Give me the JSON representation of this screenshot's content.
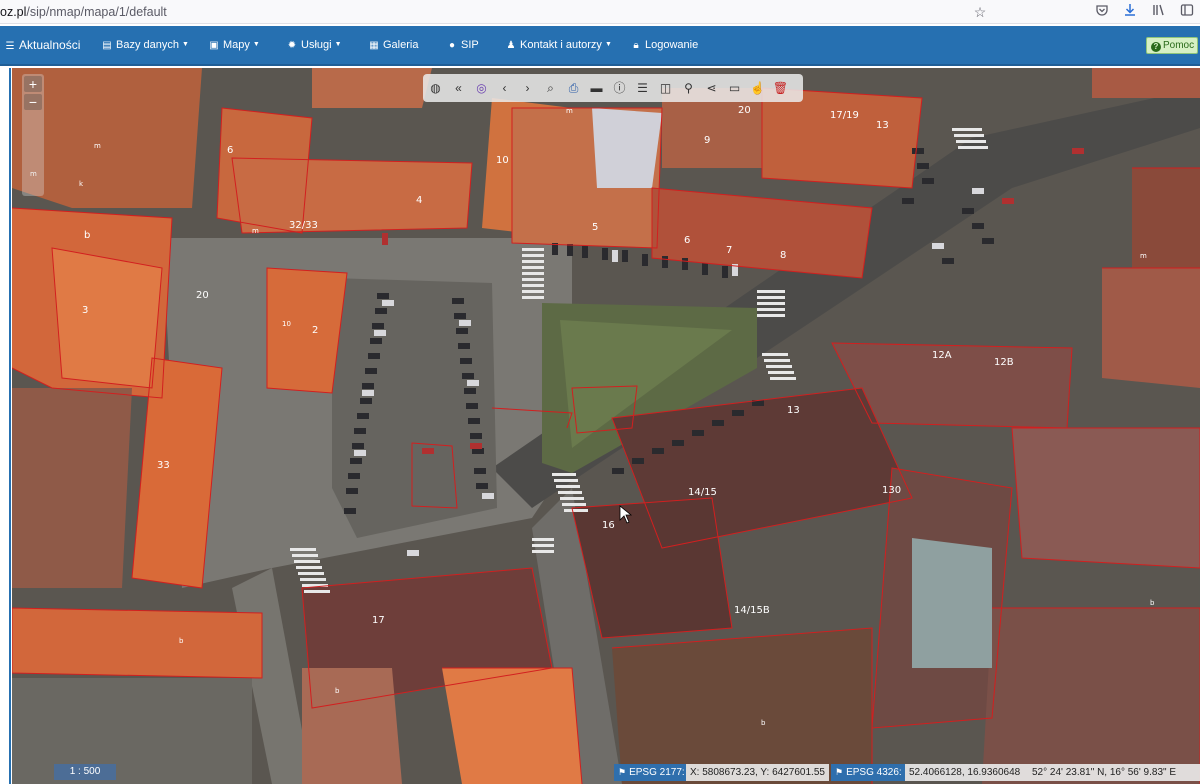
{
  "browser": {
    "url_host": "oz.pl",
    "url_path": "/sip/nmap/mapa/1/default",
    "icons": [
      "star-icon",
      "pocket-icon",
      "download-icon",
      "library-icon",
      "sidebar-icon"
    ]
  },
  "navbar": {
    "items": [
      {
        "label": "Aktualności",
        "icon": "menu-icon"
      },
      {
        "label": "Bazy danych",
        "icon": "list-icon",
        "dropdown": true
      },
      {
        "label": "Mapy",
        "icon": "picture-icon",
        "dropdown": true
      },
      {
        "label": "Usługi",
        "icon": "gear-icon",
        "dropdown": true
      },
      {
        "label": "Galeria",
        "icon": "grid-icon"
      },
      {
        "label": "SIP",
        "icon": "info-icon"
      },
      {
        "label": "Kontakt i autorzy",
        "icon": "user-icon",
        "dropdown": true
      },
      {
        "label": "Logowanie",
        "icon": "lock-icon"
      }
    ],
    "help_label": "Pomoc",
    "bg_color": "#2670b1"
  },
  "map": {
    "zoom_in": "+",
    "zoom_out": "−",
    "toolbar_icons": [
      "globe-icon",
      "double-left-icon",
      "eye-off-icon",
      "chevron-left-icon",
      "chevron-right-icon",
      "search-icon",
      "print-icon",
      "ruler-icon",
      "info-icon",
      "list-icon",
      "layout-icon",
      "marker-icon",
      "share-icon",
      "comment-icon",
      "hand-icon",
      "trash-icon"
    ],
    "parcel_labels": [
      "m",
      "k",
      "m",
      "b",
      "m",
      "m",
      "6",
      "4",
      "32/33",
      "10",
      "5",
      "6",
      "7",
      "8",
      "20",
      "9",
      "17/19",
      "13",
      "3",
      "10",
      "2",
      "33",
      "12A",
      "12B",
      "13",
      "14/15",
      "130",
      "16",
      "14/15B",
      "17",
      "b",
      "b",
      "b",
      "b",
      "m"
    ],
    "street_labels": [
      "20",
      "3",
      "10"
    ]
  },
  "status": {
    "scale": "1 : 500",
    "epsg_a_label": "EPSG 2177:",
    "epsg_a_value": "X: 5808673.23, Y: 6427601.55",
    "epsg_b_label": "EPSG 4326:",
    "epsg_b_value": "52.4066128, 16.9360648",
    "epsg_b_dms": "52° 24' 23.81\" N, 16° 56' 9.83\" E"
  }
}
